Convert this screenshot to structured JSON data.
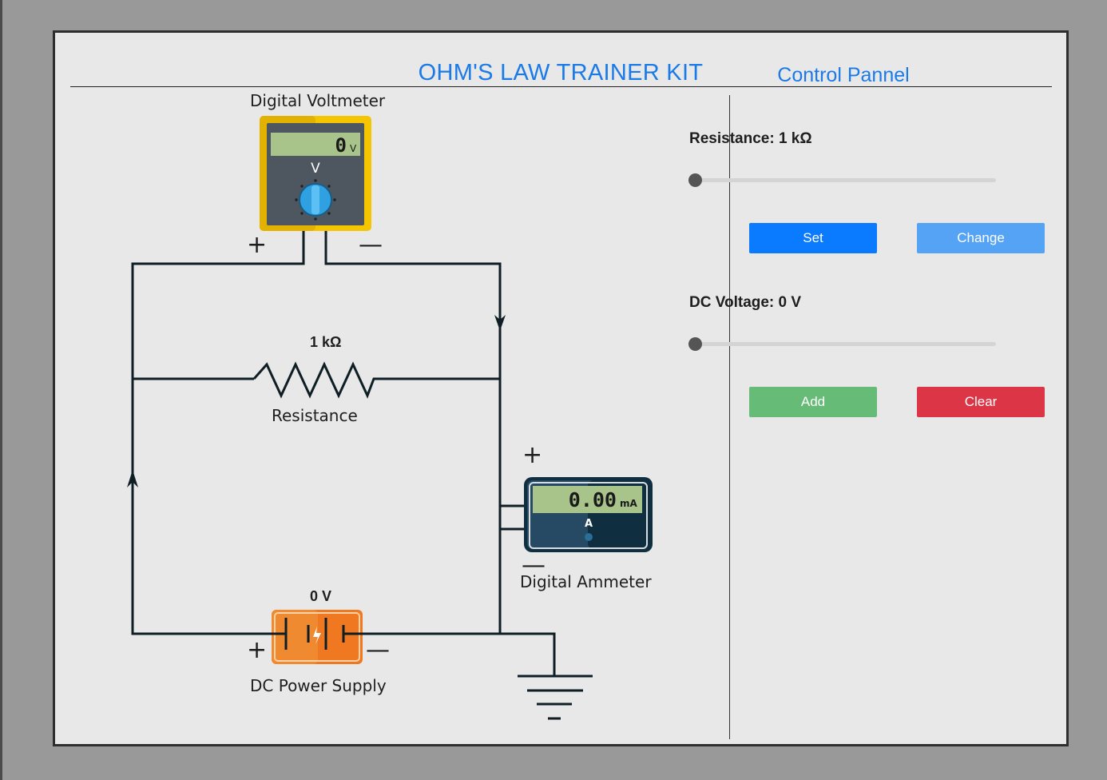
{
  "app": {
    "title": "OHM'S LAW TRAINER KIT"
  },
  "circuit": {
    "voltmeter": {
      "label": "Digital Voltmeter",
      "reading": "0",
      "unit": "V",
      "dial_label": "V"
    },
    "ammeter": {
      "label": "Digital Ammeter",
      "reading": "0.00",
      "unit": "mA",
      "mode_label": "A"
    },
    "resistor": {
      "value_label": "1 kΩ",
      "label": "Resistance"
    },
    "power_supply": {
      "value_label": "0 V",
      "label": "DC Power Supply"
    },
    "signs": {
      "plus": "+",
      "minus": "—"
    }
  },
  "control_panel": {
    "title": "Control Pannel",
    "resistance": {
      "label": "Resistance: 1 kΩ",
      "slider_level": 0
    },
    "voltage": {
      "label": "DC Voltage: 0 V",
      "slider_level": 0
    },
    "buttons": {
      "set": "Set",
      "change": "Change",
      "add": "Add",
      "clear": "Clear"
    }
  },
  "colors": {
    "title_blue": "#1a7ae8",
    "set": "#0a7bff",
    "change": "#55a3f5",
    "add": "#66bb77",
    "clear": "#dc3545",
    "voltmeter_body": "#f5c500",
    "supply_body": "#f07820",
    "ammeter_body": "#264a63",
    "lcd": "#a8c48a",
    "wire": "#0f1e24"
  }
}
